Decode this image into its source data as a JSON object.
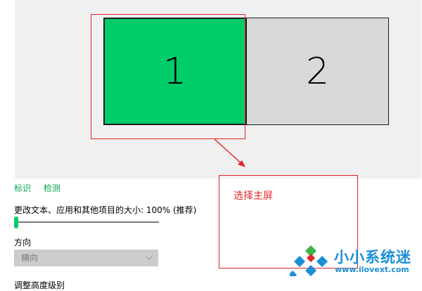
{
  "monitors": {
    "monitor1_label": "1",
    "monitor2_label": "2",
    "selected_color": "#00cc6a",
    "unselected_color": "#d9d9d9"
  },
  "annotation": {
    "callout_text": "选择主屏",
    "color": "#e0262b"
  },
  "links": {
    "identify": "标识",
    "detect": "检测",
    "color": "#00a550"
  },
  "scale": {
    "label": "更改文本、应用和其他项目的大小: 100% (推荐)",
    "value_percent": 100,
    "thumb_color": "#00cc6a"
  },
  "orientation": {
    "label": "方向",
    "selected_value": "横向",
    "chevron_icon": "chevron-down-icon"
  },
  "next_section": {
    "label": "调整高度级别"
  },
  "watermark": {
    "text_cn": "小小系统迷",
    "url": "www.ilovext.com"
  }
}
